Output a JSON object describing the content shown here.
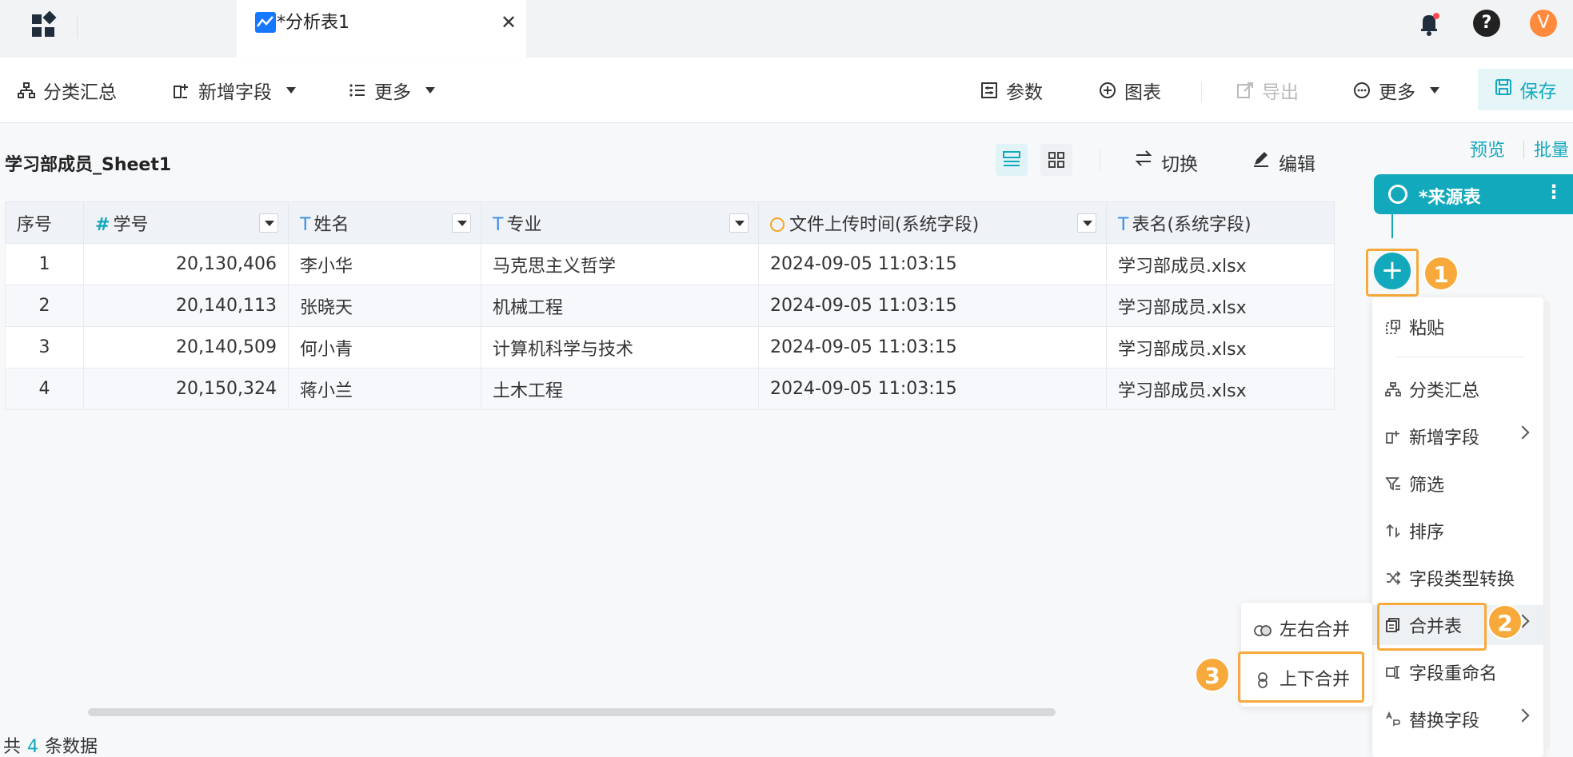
{
  "topbar": {
    "tab_label": "*分析表1",
    "avatar_letter": "V",
    "help_glyph": "?",
    "close_glyph": "✕",
    "icons": [
      "apps-icon",
      "chart-tab-icon",
      "bell-icon",
      "help-icon"
    ]
  },
  "toolbar": {
    "group_summary": "分类汇总",
    "add_field": "新增字段",
    "more_left": "更多",
    "params": "参数",
    "chart": "图表",
    "export": "导出",
    "more_right": "更多",
    "save": "保存"
  },
  "sheet": {
    "title": "学习部成员_Sheet1",
    "switch_label": "切换",
    "edit_label": "编辑"
  },
  "table": {
    "headers": [
      {
        "label": "序号",
        "type": ""
      },
      {
        "label": "学号",
        "type": "#"
      },
      {
        "label": "姓名",
        "type": "T"
      },
      {
        "label": "专业",
        "type": "T"
      },
      {
        "label": "文件上传时间(系统字段)",
        "type": "clock"
      },
      {
        "label": "表名(系统字段)",
        "type": "T"
      }
    ],
    "rows": [
      [
        "1",
        "20,130,406",
        "李小华",
        "马克思主义哲学",
        "2024-09-05 11:03:15",
        "学习部成员.xlsx"
      ],
      [
        "2",
        "20,140,113",
        "张晓天",
        "机械工程",
        "2024-09-05 11:03:15",
        "学习部成员.xlsx"
      ],
      [
        "3",
        "20,140,509",
        "何小青",
        "计算机科学与技术",
        "2024-09-05 11:03:15",
        "学习部成员.xlsx"
      ],
      [
        "4",
        "20,150,324",
        "蒋小兰",
        "土木工程",
        "2024-09-05 11:03:15",
        "学习部成员.xlsx"
      ]
    ]
  },
  "footer": {
    "prefix": "共",
    "count": "4",
    "suffix": "条数据"
  },
  "right_panel": {
    "preview": "预览",
    "batch": "批量",
    "source_node": "*来源表",
    "more_glyph": "⋮",
    "add_glyph": "+"
  },
  "menu": {
    "paste": "粘贴",
    "group_summary": "分类汇总",
    "add_field": "新增字段",
    "filter": "筛选",
    "sort": "排序",
    "type_convert": "字段类型转换",
    "merge_table": "合并表",
    "rename_field": "字段重命名",
    "replace_field": "替换字段"
  },
  "submenu": {
    "left_right": "左右合并",
    "top_bottom": "上下合并"
  },
  "badges": {
    "step1": "1",
    "step2": "2",
    "step3": "3"
  },
  "colors": {
    "accent": "#13a9bd",
    "highlight": "#f7a93b",
    "avatar": "#ff8a3d"
  }
}
